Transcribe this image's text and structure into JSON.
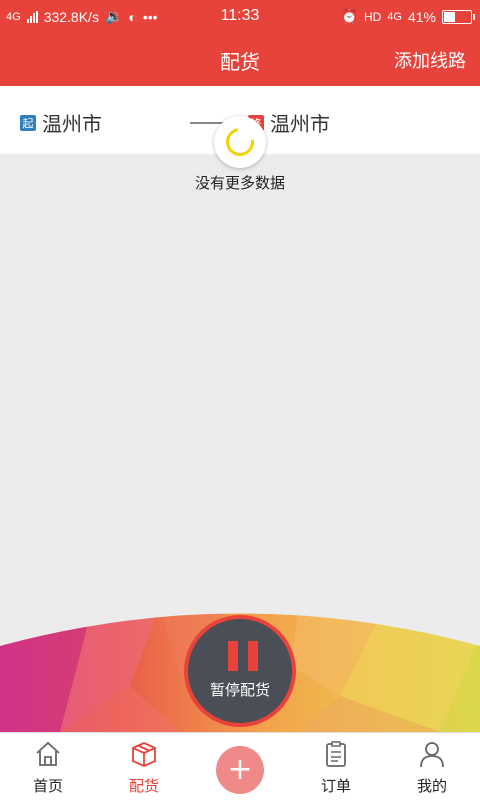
{
  "status_bar": {
    "network": "4G",
    "speed": "332.8K/s",
    "time": "11:33",
    "hd": "HD",
    "network_right": "4G",
    "battery": "41%",
    "icons": [
      "signal-icon",
      "sound-icon",
      "compass-icon",
      "more-icon",
      "alarm-icon",
      "battery-icon"
    ]
  },
  "header": {
    "title": "配货",
    "add_route": "添加线路"
  },
  "route": {
    "start_badge": "起",
    "from_city": "温州市",
    "end_badge": "终",
    "to_city": "温州市"
  },
  "list": {
    "empty_text": "没有更多数据"
  },
  "pause": {
    "label": "暂停配货"
  },
  "tabs": [
    {
      "label": "首页",
      "icon": "home-icon",
      "active": false
    },
    {
      "label": "配货",
      "icon": "box-icon",
      "active": true
    },
    {
      "label": "",
      "icon": "plus-icon",
      "active": false
    },
    {
      "label": "订单",
      "icon": "clipboard-icon",
      "active": false
    },
    {
      "label": "我的",
      "icon": "user-icon",
      "active": false
    }
  ],
  "colors": {
    "brand_red": "#e8433b",
    "plus_pink": "#f08a88",
    "pause_dark": "#4a4e56"
  }
}
